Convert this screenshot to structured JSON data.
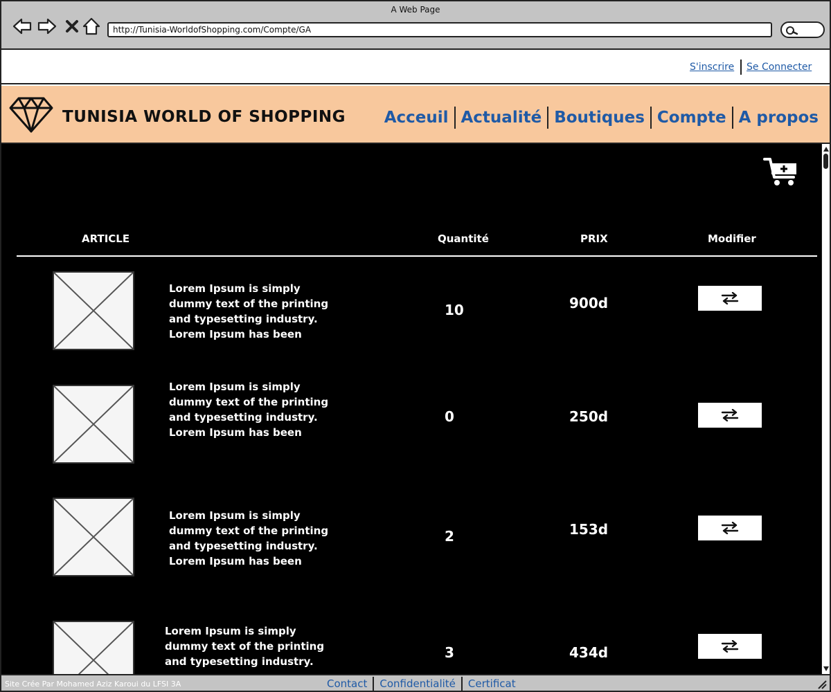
{
  "browser": {
    "title": "A Web Page",
    "url": "http://Tunisia-WorldofShopping.com/Compte/GA",
    "icons": [
      "back-arrow-icon",
      "forward-arrow-icon",
      "close-icon",
      "home-icon",
      "search-icon"
    ]
  },
  "auth": {
    "register": "S'inscrire",
    "login": "Se Connecter"
  },
  "header": {
    "brand": "TUNISIA WORLD OF SHOPPING",
    "logo_icon": "diamond-icon",
    "nav": [
      "Acceuil",
      "Actualité",
      "Boutiques",
      "Compte",
      "A propos"
    ]
  },
  "cart": {
    "icon": "cart-add-icon"
  },
  "table": {
    "headers": {
      "article": "ARTICLE",
      "quantity": "Quantité",
      "price": "PRIX",
      "modify": "Modifier"
    },
    "rows": [
      {
        "desc": "Lorem Ipsum is simply\ndummy text of the printing\nand typesetting industry.\nLorem Ipsum has been",
        "quantity": "10",
        "price": "900d"
      },
      {
        "desc": "Lorem Ipsum is simply\ndummy text of the printing\nand typesetting industry.\nLorem Ipsum has been",
        "quantity": "0",
        "price": "250d"
      },
      {
        "desc": "Lorem Ipsum is simply\ndummy text of the printing\nand typesetting industry.\nLorem Ipsum has been",
        "quantity": "2",
        "price": "153d"
      },
      {
        "desc": "Lorem Ipsum is simply\ndummy text of the printing\nand typesetting industry.",
        "quantity": "3",
        "price": "434d"
      }
    ],
    "modify_icon": "swap-arrows-icon",
    "image_icon": "image-placeholder-icon"
  },
  "footer": {
    "credit": "Site Crée Par Mohamed Aziz Karoui du LFSI 3A",
    "links": [
      "Contact",
      "Confidentialité",
      "Certificat"
    ]
  },
  "colors": {
    "header_bg": "#f8c89d",
    "link": "#1f5aa6",
    "main_bg": "#000000",
    "chrome_bg": "#c4c4c4"
  }
}
